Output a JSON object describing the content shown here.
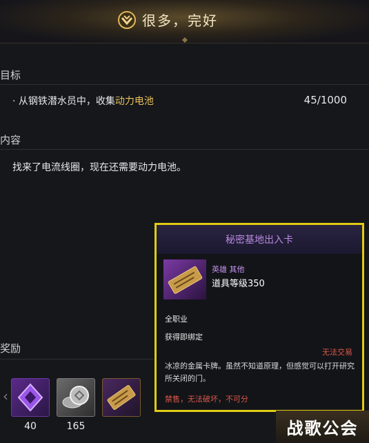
{
  "banner": {
    "title": "很多，完好"
  },
  "objective": {
    "label": "目标",
    "bullet": "·",
    "text_prefix": "从钢铁潜水员中，收集",
    "item_name": "动力电池",
    "progress": "45/1000"
  },
  "content": {
    "label": "内容",
    "text": "找来了电流线圈，现在还需要动力电池。"
  },
  "rewards": {
    "label": "奖励",
    "prev_arrow": "‹",
    "items": [
      {
        "icon": "purple-crystal-icon",
        "count": "40"
      },
      {
        "icon": "silver-coins-icon",
        "count": "165"
      },
      {
        "icon": "pass-card-icon",
        "count": ""
      }
    ]
  },
  "tooltip": {
    "title": "秘密基地出入卡",
    "grade": "英雄 其他",
    "item_level": "道具等级350",
    "class": "全职业",
    "bind": "获得即绑定",
    "trade": "无法交易",
    "description": "冰凉的金属卡牌。虽然不知道原理，但感觉可以打开研究所关闭的门。",
    "restrictions": "禁售，无法破坏，不可分"
  },
  "watermark": {
    "text": "战歌公会"
  },
  "colors": {
    "tooltip_border": "#e2cc14",
    "highlight": "#e7c25b",
    "title_purple": "#b98ae0"
  }
}
